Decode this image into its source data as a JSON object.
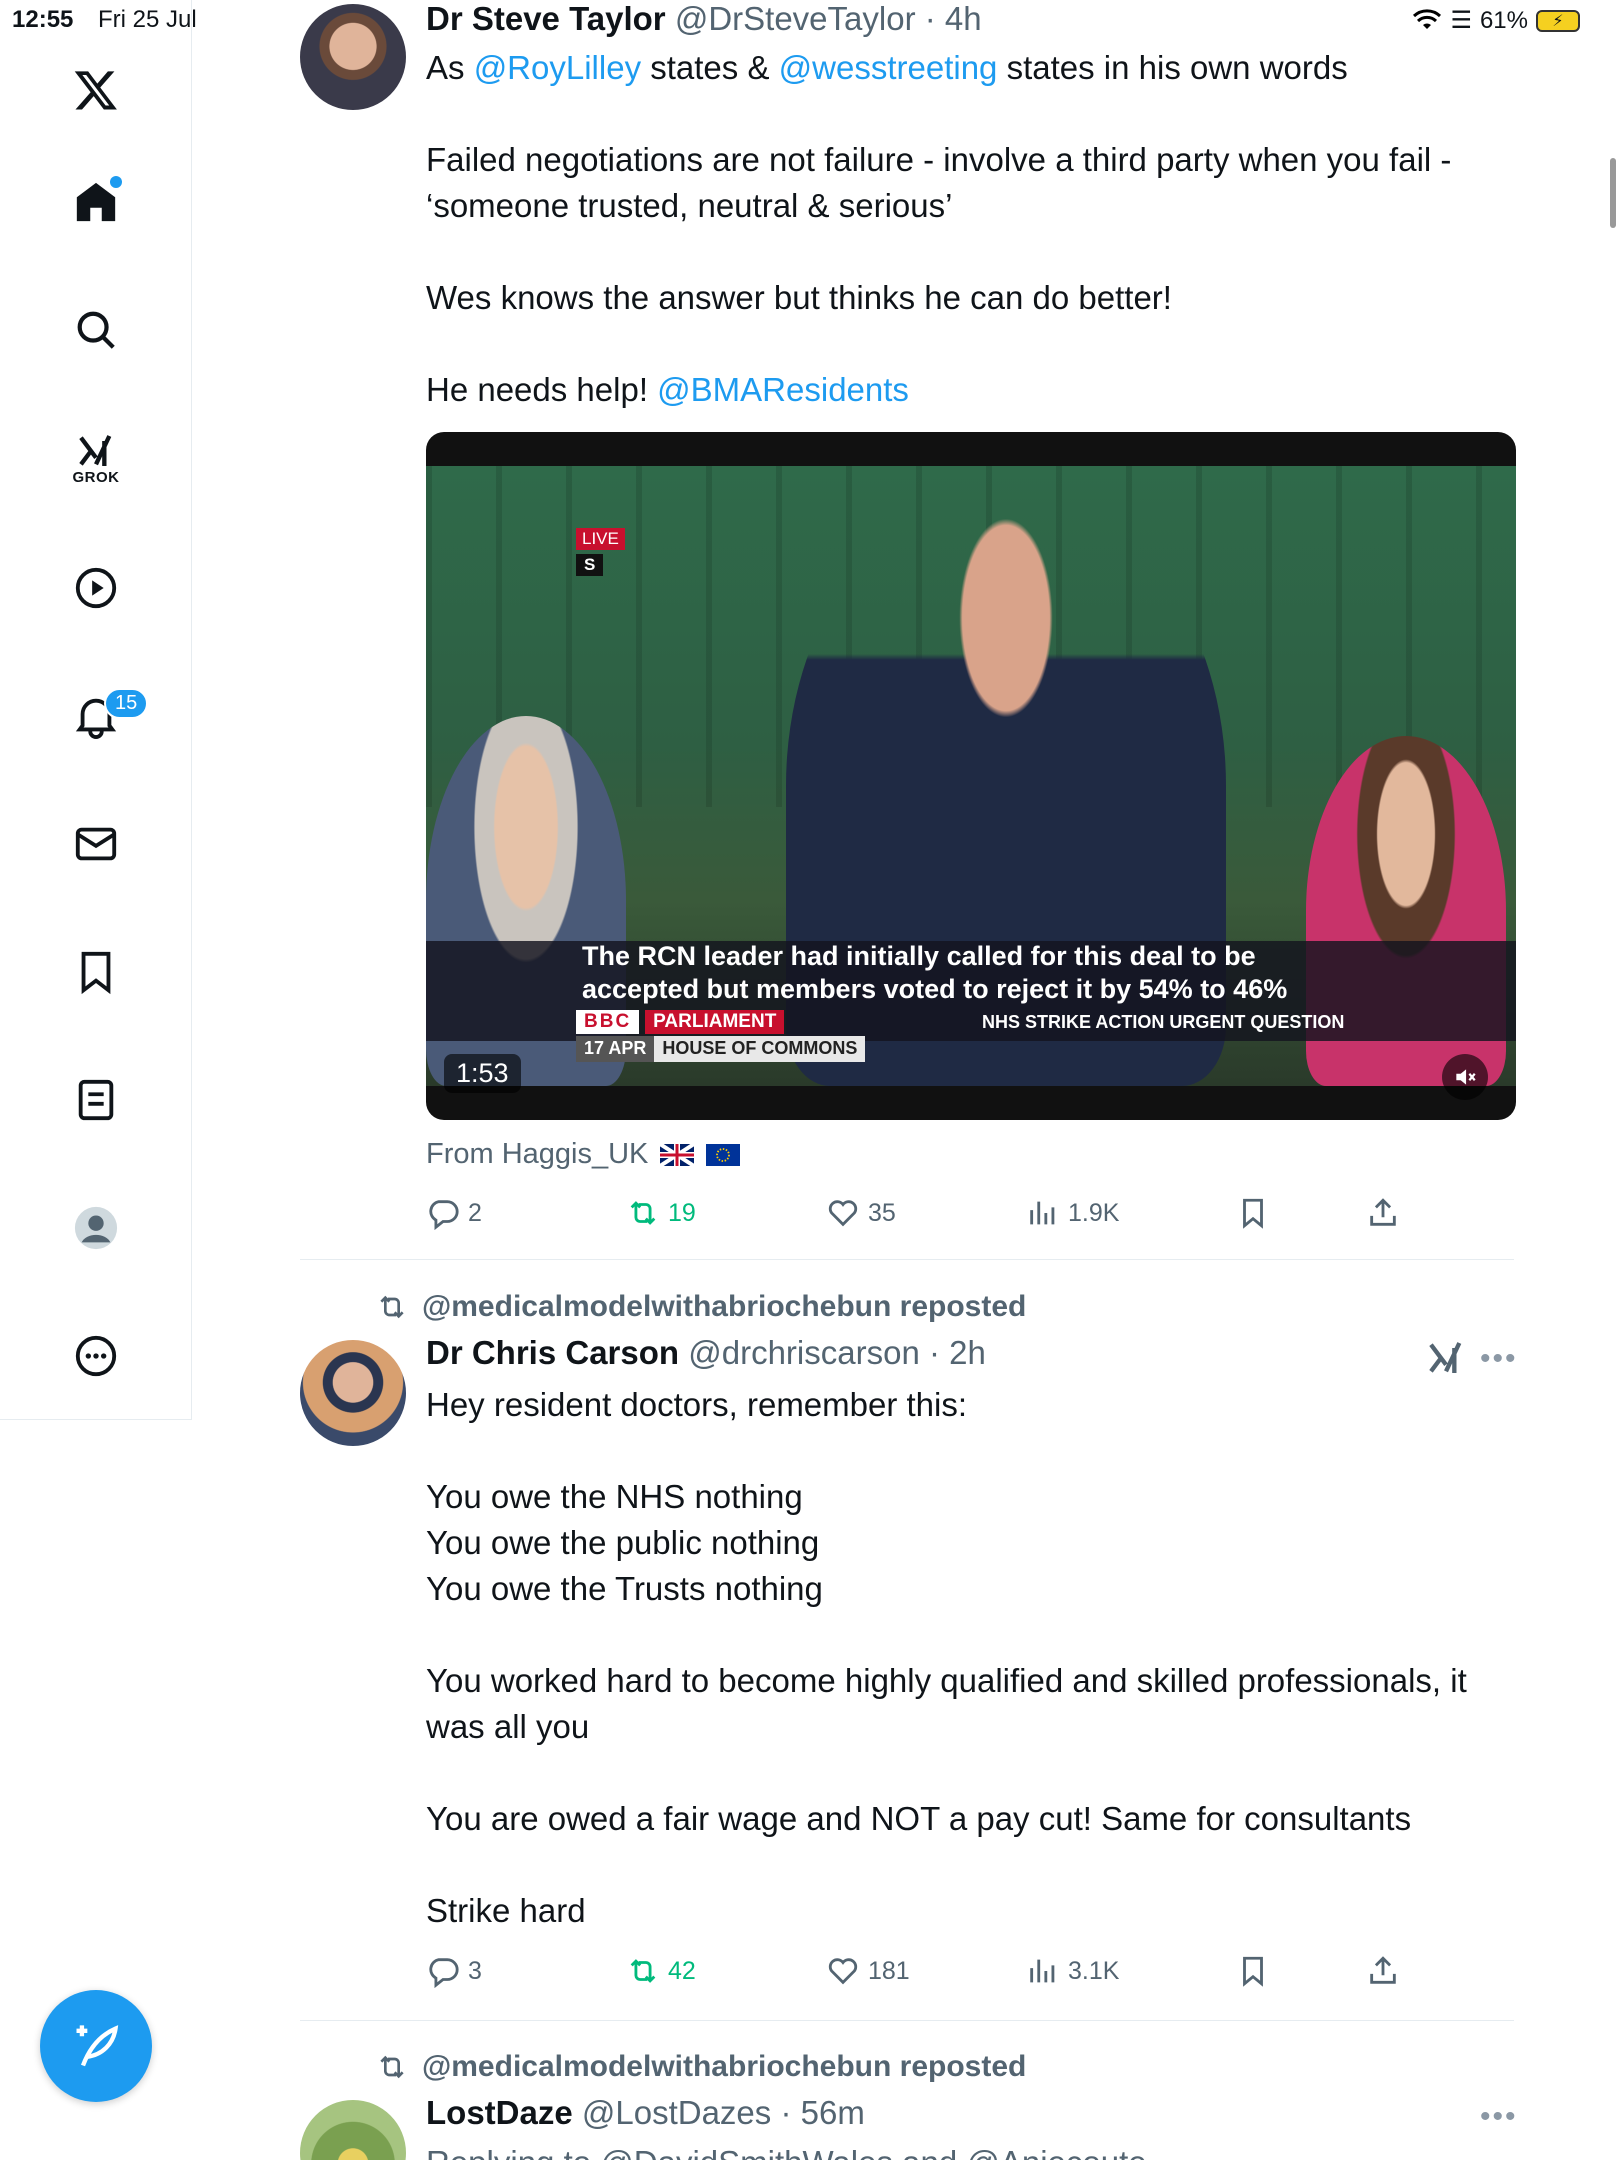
{
  "status_bar": {
    "time": "12:55",
    "date": "Fri 25 Jul",
    "battery": "61%"
  },
  "sidebar": {
    "grok_label": "GROK",
    "notification_count": "15"
  },
  "tweet1": {
    "name": "Dr Steve Taylor",
    "handle": "@DrSteveTaylor",
    "time": "· 4h",
    "line1_prefix": "As ",
    "mention1": "@RoyLilley",
    "line1_mid": " states & ",
    "mention2": "@wesstreeting",
    "line1_suffix": " states in his own words",
    "para2": "Failed negotiations are not failure - involve a third party when you fail - ‘someone trusted, neutral & serious’",
    "para3": "Wes knows the answer but thinks he can do better!",
    "para4_prefix": "He needs help! ",
    "mention3": "@BMAResidents",
    "video": {
      "live": "LIVE",
      "s": "S",
      "caption": "The RCN leader had initially called for this deal to be accepted but members voted to reject it by 54% to 46%",
      "bbc": "BBC",
      "parliament": "PARLIAMENT",
      "strike_q": "NHS STRIKE ACTION URGENT QUESTION",
      "date": "17 APR",
      "house": "HOUSE OF COMMONS",
      "duration": "1:53"
    },
    "from": "From Haggis_UK",
    "replies": "2",
    "reposts": "19",
    "likes": "35",
    "views": "1.9K"
  },
  "tweet2": {
    "repost_by": "@medicalmodelwithabriochebun reposted",
    "name": "Dr Chris Carson",
    "handle": "@drchriscarson",
    "time": "· 2h",
    "lines": [
      "Hey resident doctors, remember this:",
      "",
      "You owe the NHS nothing",
      "You owe the public nothing",
      "You owe the Trusts nothing",
      "",
      "You worked hard to become highly qualified and skilled professionals, it was all you",
      "",
      "You are owed a fair wage and NOT a pay cut! Same for consultants",
      "",
      "Strike hard"
    ],
    "replies": "3",
    "reposts": "42",
    "likes": "181",
    "views": "3.1K"
  },
  "tweet3": {
    "repost_by": "@medicalmodelwithabriochebun reposted",
    "name": "LostDaze",
    "handle": "@LostDazes",
    "time": "· 56m",
    "partial": "Replying to @DavidSmithWales and @Anjecoute"
  },
  "colors": {
    "accent": "#1d9bf0",
    "repost_green": "#00ba7c",
    "muted": "#536471"
  }
}
